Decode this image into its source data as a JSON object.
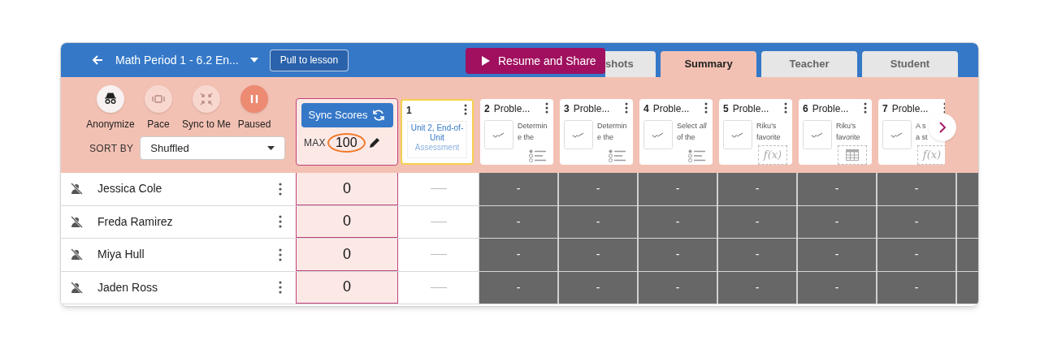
{
  "header": {
    "title": "Math Period 1 - 6.2 En...",
    "pull_button": "Pull to lesson",
    "resume_button": "Resume and Share"
  },
  "tabs": [
    {
      "label": "shots",
      "selected": false
    },
    {
      "label": "Summary",
      "selected": true
    },
    {
      "label": "Teacher",
      "selected": false
    },
    {
      "label": "Student",
      "selected": false
    }
  ],
  "controls": [
    {
      "kind": "anonymize",
      "label": "Anonymize",
      "on": true
    },
    {
      "kind": "pace",
      "label": "Pace",
      "on": false
    },
    {
      "kind": "sync",
      "label": "Sync to Me",
      "on": false
    },
    {
      "kind": "pause",
      "label": "Paused",
      "on": true
    }
  ],
  "sort": {
    "label": "SORT BY",
    "value": "Shuffled"
  },
  "scores": {
    "sync_button": "Sync Scores",
    "max_label": "MAX",
    "max_value": "100"
  },
  "cards": [
    {
      "number": "1",
      "lines": [
        "Unit 2, End-of-Unit"
      ],
      "subtext": "Assessment",
      "kind": "assessment",
      "selected": true
    },
    {
      "number": "2",
      "title": "Proble...",
      "lines": [
        "Determin",
        "e the"
      ],
      "kind": "choice",
      "selected": false
    },
    {
      "number": "3",
      "title": "Proble...",
      "lines": [
        "Determin",
        "e the"
      ],
      "kind": "choice",
      "selected": false
    },
    {
      "number": "4",
      "title": "Proble...",
      "lines": [
        "Select *all*",
        "of the"
      ],
      "kind": "choice",
      "selected": false
    },
    {
      "number": "5",
      "title": "Proble...",
      "lines": [
        "Riku’s",
        "favorite"
      ],
      "kind": "function",
      "footer": "f(x)",
      "selected": false
    },
    {
      "number": "6",
      "title": "Proble...",
      "lines": [
        "Riku’s",
        "favorite"
      ],
      "kind": "table",
      "selected": false
    },
    {
      "number": "7",
      "title": "Proble...",
      "lines": [
        "A s",
        "a st"
      ],
      "kind": "function",
      "footer": "f(x)",
      "selected": false
    }
  ],
  "rows": [
    {
      "name": "Jessica Cole",
      "score": "0",
      "cells": [
        "-",
        "-",
        "-",
        "-",
        "-",
        "-"
      ]
    },
    {
      "name": "Freda Ramirez",
      "score": "0",
      "cells": [
        "-",
        "-",
        "-",
        "-",
        "-",
        "-"
      ]
    },
    {
      "name": "Miya Hull",
      "score": "0",
      "cells": [
        "-",
        "-",
        "-",
        "-",
        "-",
        "-"
      ]
    },
    {
      "name": "Jaden Ross",
      "score": "0",
      "cells": [
        "-",
        "-",
        "-",
        "-",
        "-",
        "-"
      ]
    }
  ]
}
